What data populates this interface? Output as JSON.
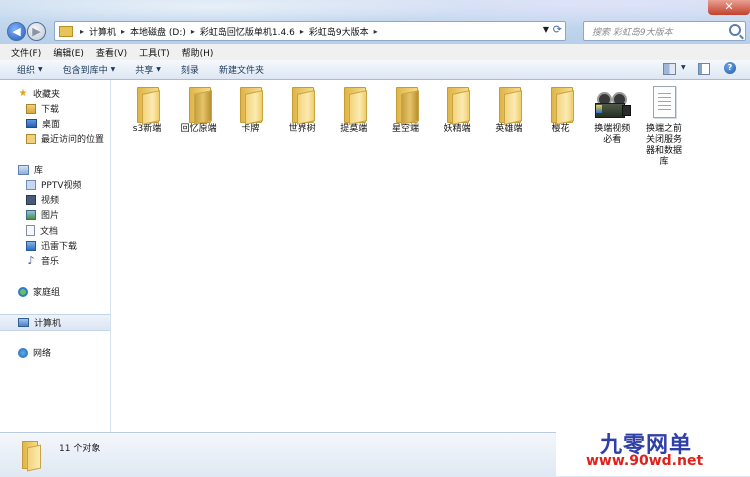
{
  "window": {
    "breadcrumb": [
      "计算机",
      "本地磁盘 (D:)",
      "彩虹岛回忆版单机1.4.6",
      "彩虹岛9大版本"
    ],
    "search_placeholder": "搜索 彩虹岛9大版本",
    "close_glyph": "✕"
  },
  "menubar": [
    "文件(F)",
    "编辑(E)",
    "查看(V)",
    "工具(T)",
    "帮助(H)"
  ],
  "toolbar": [
    {
      "label": "组织",
      "dropdown": true
    },
    {
      "label": "包含到库中",
      "dropdown": true
    },
    {
      "label": "共享",
      "dropdown": true
    },
    {
      "label": "刻录",
      "dropdown": false
    },
    {
      "label": "新建文件夹",
      "dropdown": false
    }
  ],
  "navpane": {
    "favorites": {
      "label": "收藏夹",
      "items": [
        "下载",
        "桌面",
        "最近访问的位置"
      ]
    },
    "library": {
      "label": "库",
      "items": [
        "PPTV视频",
        "视频",
        "图片",
        "文档",
        "迅雷下载",
        "音乐"
      ]
    },
    "homegroup": "家庭组",
    "computer": "计算机",
    "network": "网络"
  },
  "files": [
    {
      "name": "s3新端",
      "type": "folder"
    },
    {
      "name": "回忆原端",
      "type": "folder"
    },
    {
      "name": "卡牌",
      "type": "folder"
    },
    {
      "name": "世界树",
      "type": "folder"
    },
    {
      "name": "提莫端",
      "type": "folder"
    },
    {
      "name": "星空端",
      "type": "folder"
    },
    {
      "name": "妖精端",
      "type": "folder"
    },
    {
      "name": "英雄端",
      "type": "folder"
    },
    {
      "name": "樱花",
      "type": "folder"
    },
    {
      "name": "换端视频必看",
      "type": "video"
    },
    {
      "name": "换端之前关闭服务器和数据库",
      "type": "text"
    }
  ],
  "status": {
    "count": "11 个对象"
  },
  "watermark": {
    "title": "九零网单",
    "url": "www.90wd.net"
  }
}
